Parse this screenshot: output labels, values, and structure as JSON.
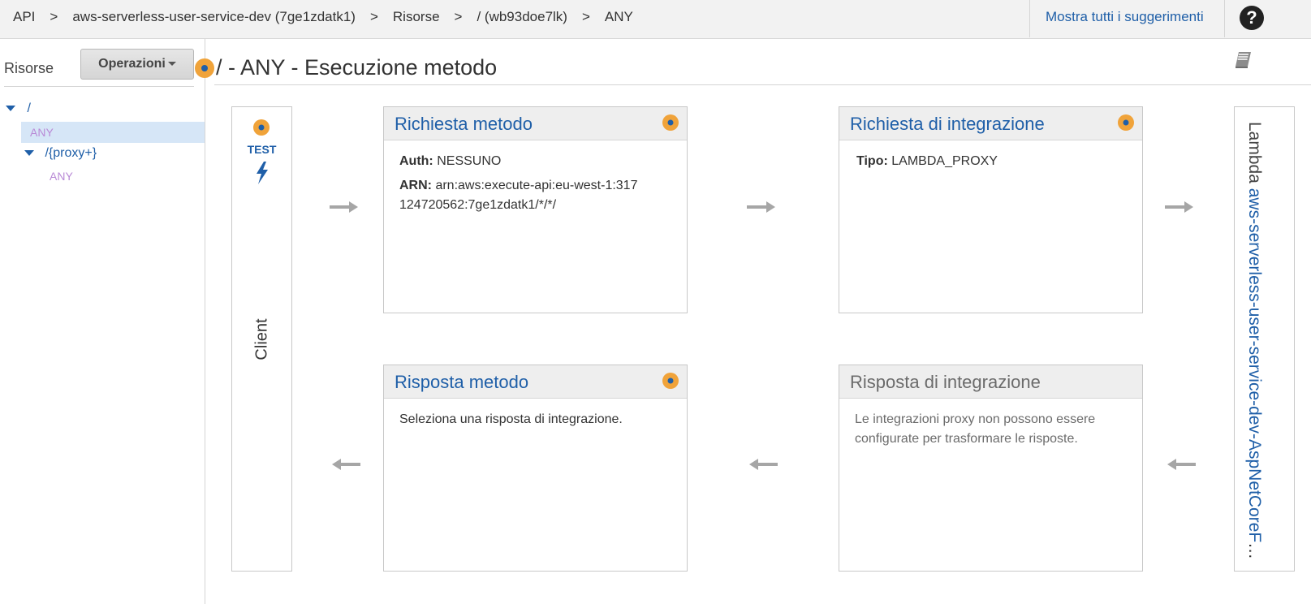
{
  "breadcrumb": {
    "items": [
      "API",
      "aws-serverless-user-service-dev (7ge1zdatk1)",
      "Risorse",
      "/ (wb93doe7lk)",
      "ANY"
    ],
    "separator": ">"
  },
  "topbar": {
    "suggestions_link": "Mostra tutti i suggerimenti",
    "help_glyph": "?"
  },
  "sidebar": {
    "title": "Risorse",
    "operations_button": "Operazioni",
    "tree": {
      "root": "/",
      "root_method": "ANY",
      "proxy": "/{proxy+}",
      "proxy_method": "ANY"
    }
  },
  "main": {
    "title": "/ - ANY - Esecuzione metodo",
    "client": {
      "test_label": "TEST",
      "label": "Client"
    },
    "method_request": {
      "title": "Richiesta metodo",
      "auth_key": "Auth:",
      "auth_value": "NESSUNO",
      "arn_key": "ARN:",
      "arn_value": "arn:aws:execute-api:eu-west-1:317124720562:7ge1zdatk1/*/*/"
    },
    "integration_request": {
      "title": "Richiesta di integrazione",
      "type_key": "Tipo:",
      "type_value": "LAMBDA_PROXY"
    },
    "method_response": {
      "title": "Risposta metodo",
      "text": "Seleziona una risposta di integrazione."
    },
    "integration_response": {
      "title": "Risposta di integrazione",
      "text": "Le integrazioni proxy non possono essere configurate per trasformare le risposte."
    },
    "lambda": {
      "label": "Lambda",
      "function": "aws-serverless-user-service-dev-AspNetCoreFunction"
    }
  },
  "colors": {
    "link": "#1f5fa8",
    "badge_orange": "#f0a33a",
    "method_purple": "#b98ad6",
    "selected_row": "#d6e6f7",
    "arrow_grey": "#a6a6a6"
  },
  "icons": {
    "help": "help-icon",
    "book": "book-icon",
    "bolt": "lightning-bolt-icon",
    "arrow_right": "arrow-right-icon",
    "arrow_left": "arrow-left-icon",
    "tree_caret": "caret-down-icon",
    "badge": "orange-badge-icon"
  }
}
